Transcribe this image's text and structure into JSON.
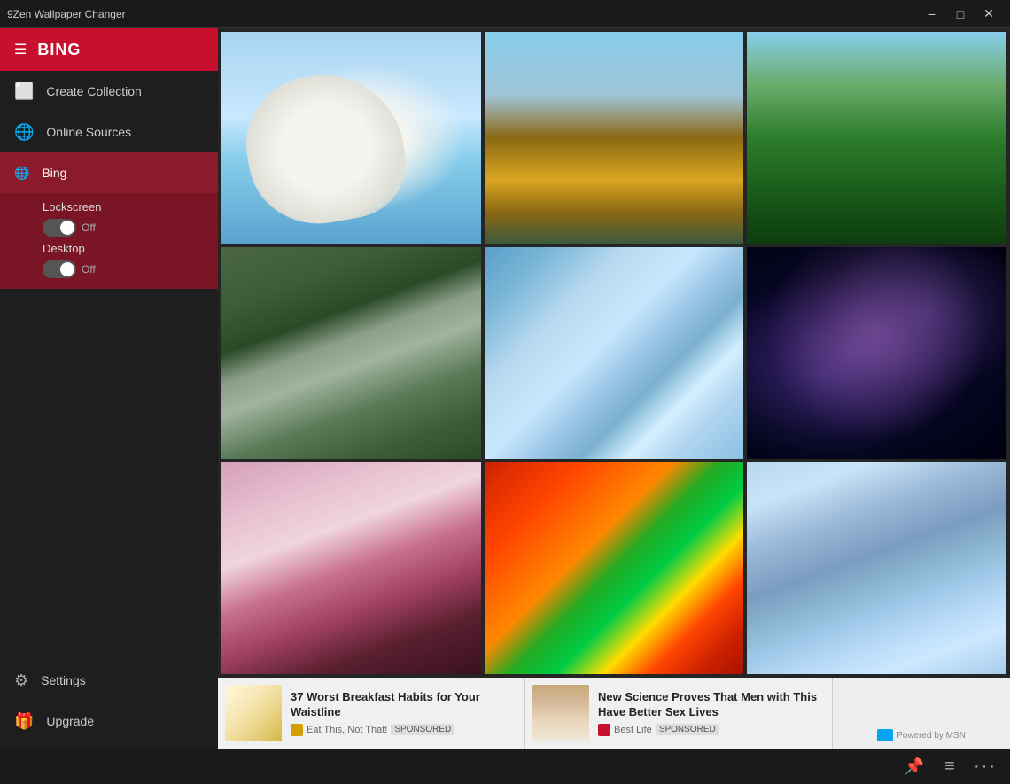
{
  "titleBar": {
    "appName": "9Zen Wallpaper Changer",
    "minimizeLabel": "−",
    "maximizeLabel": "□",
    "closeLabel": "✕"
  },
  "sidebar": {
    "title": "BING",
    "hamburgerIcon": "☰",
    "items": [
      {
        "id": "create-collection",
        "label": "Create Collection",
        "icon": "⬜"
      },
      {
        "id": "online-sources",
        "label": "Online Sources",
        "icon": "🌐"
      }
    ],
    "bingItem": {
      "label": "Bing",
      "icon": "🌐",
      "lockscreen": {
        "label": "Lockscreen",
        "status": "Off"
      },
      "desktop": {
        "label": "Desktop",
        "status": "Off"
      }
    },
    "bottomItems": [
      {
        "id": "settings",
        "label": "Settings",
        "icon": "⚙"
      },
      {
        "id": "upgrade",
        "label": "Upgrade",
        "icon": "🎁"
      }
    ]
  },
  "wallpapers": [
    {
      "id": "pelican",
      "class": "wp-pelican",
      "alt": "White Pelican"
    },
    {
      "id": "autumn",
      "class": "wp-autumn",
      "alt": "Autumn Landscape"
    },
    {
      "id": "forest",
      "class": "wp-forest",
      "alt": "Green Forest"
    },
    {
      "id": "waterfall",
      "class": "wp-waterfall",
      "alt": "Waterfall"
    },
    {
      "id": "glacier-aerial",
      "class": "wp-glacier-aerial",
      "alt": "Aerial Glacier View"
    },
    {
      "id": "milkyway",
      "class": "wp-milkyway",
      "alt": "Milky Way"
    },
    {
      "id": "cherry",
      "class": "wp-cherry",
      "alt": "Cherry Blossoms"
    },
    {
      "id": "feathers",
      "class": "wp-feathers",
      "alt": "Colorful Feathers"
    },
    {
      "id": "ice",
      "class": "wp-ice",
      "alt": "Ice Glacier"
    }
  ],
  "ads": [
    {
      "id": "ad1",
      "title": "37 Worst Breakfast Habits for Your Waistline",
      "source": "Eat This, Not That!",
      "sponsored": "SPONSORED",
      "thumbClass": "ad-thumb-egg",
      "dotClass": "yellow"
    },
    {
      "id": "ad2",
      "title": "New Science Proves That Men with This Have Better Sex Lives",
      "source": "Best Life",
      "sponsored": "SPONSORED",
      "thumbClass": "ad-thumb-person",
      "dotClass": ""
    }
  ],
  "adPowered": "Powered by MSN",
  "bottomBar": {
    "pinIcon": "📌",
    "listIcon": "≡",
    "moreIcon": "…"
  }
}
